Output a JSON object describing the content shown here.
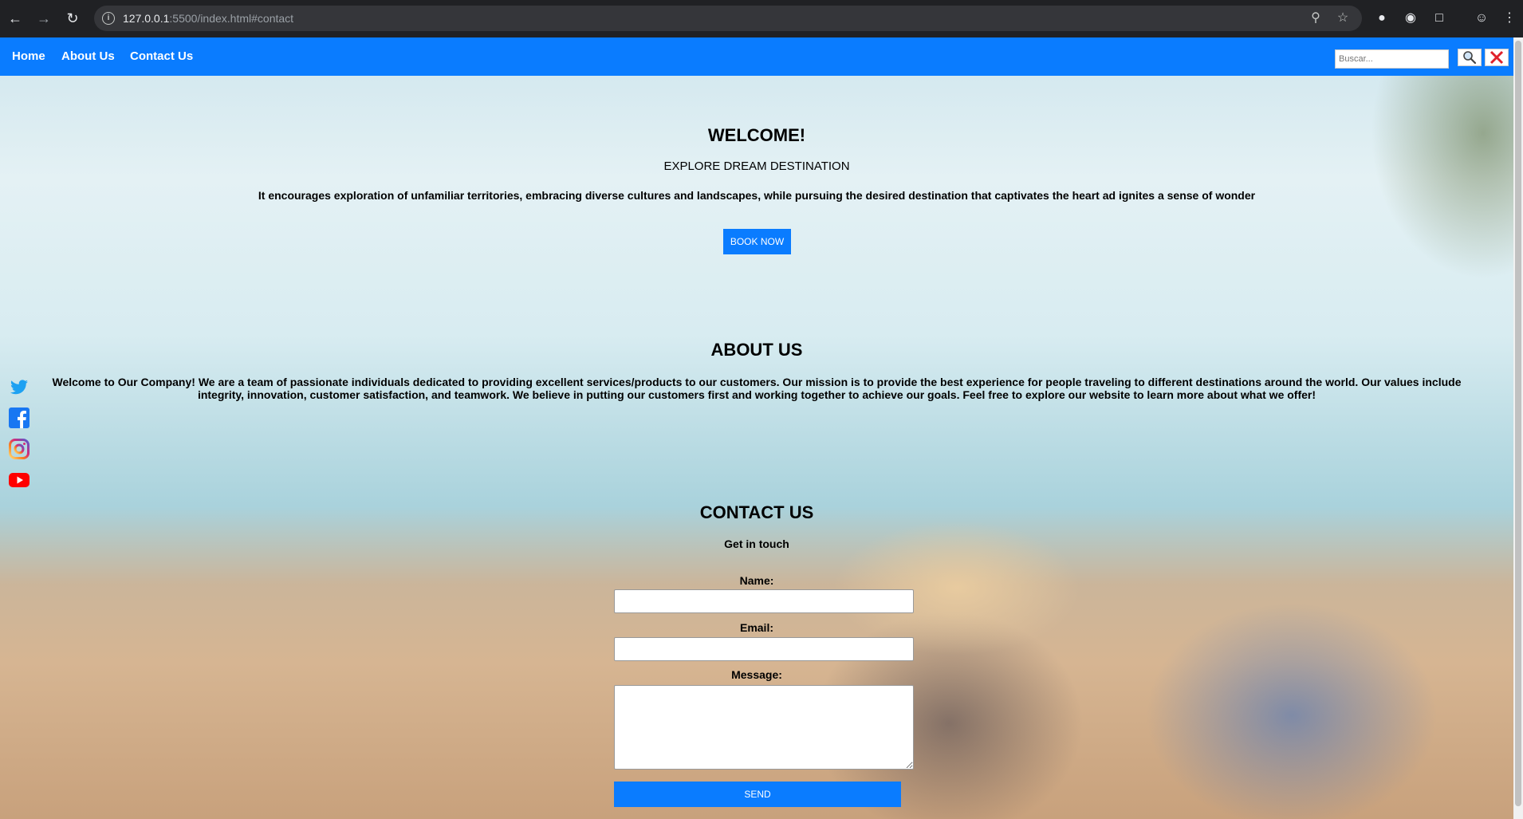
{
  "browser": {
    "url_host": "127.0.0.1",
    "url_path": ":5500/index.html#contact"
  },
  "navbar": {
    "links": [
      "Home",
      "About Us",
      "Contact Us"
    ],
    "search_placeholder": "Buscar..."
  },
  "social": {
    "icons": [
      "twitter-icon",
      "facebook-icon",
      "instagram-icon",
      "youtube-icon"
    ]
  },
  "welcome": {
    "title": "WELCOME!",
    "subtitle": "EXPLORE DREAM DESTINATION",
    "text": "It encourages exploration of unfamiliar territories, embracing diverse cultures and landscapes, while pursuing the desired destination that captivates the heart ad ignites a sense of wonder",
    "button": "BOOK NOW"
  },
  "about": {
    "title": "ABOUT US",
    "text": "Welcome to Our Company! We are a team of passionate individuals dedicated to providing excellent services/products to our customers. Our mission is to provide the best experience for people traveling to different destinations around the world. Our values include integrity, innovation, customer satisfaction, and teamwork. We believe in putting our customers first and working together to achieve our goals. Feel free to explore our website to learn more about what we offer!"
  },
  "contact": {
    "title": "CONTACT US",
    "subtitle": "Get in touch",
    "name_label": "Name:",
    "email_label": "Email:",
    "message_label": "Message:",
    "send_button": "SEND"
  },
  "colors": {
    "accent": "#0a7cff"
  }
}
